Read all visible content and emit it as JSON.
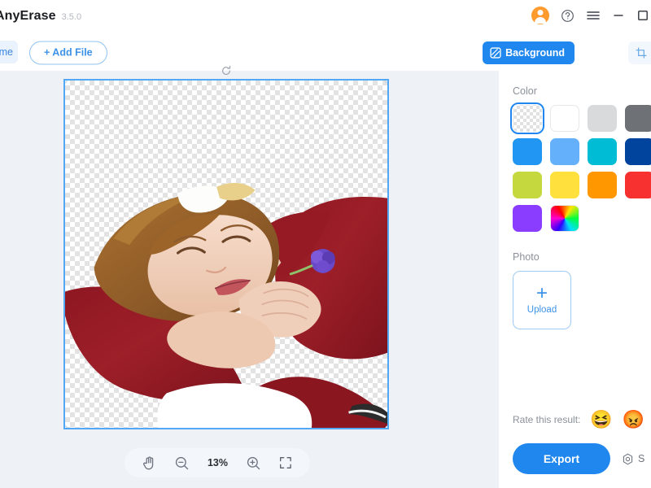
{
  "app": {
    "name": "AnyErase",
    "version": "3.5.0"
  },
  "titlebar": {
    "icons": [
      {
        "name": "account-avatar-icon",
        "label": "account"
      },
      {
        "name": "help-icon",
        "label": "?"
      },
      {
        "name": "menu-icon",
        "label": "menu"
      },
      {
        "name": "minimize-icon",
        "label": "minimize"
      },
      {
        "name": "maximize-icon",
        "label": "maximize"
      }
    ]
  },
  "toolbar": {
    "home_label": "Home",
    "home_visible_text": "me",
    "add_file_label": "+ Add File",
    "background_label": "Background",
    "resize_label": "Re",
    "resize_full_label": "Resize"
  },
  "editor": {
    "zoom_level": "13%",
    "tools": [
      {
        "name": "pan-tool",
        "label": "hand"
      },
      {
        "name": "zoom-out-button",
        "label": "zoom out"
      },
      {
        "name": "zoom-in-button",
        "label": "zoom in"
      },
      {
        "name": "fit-screen-button",
        "label": "fit to screen"
      }
    ],
    "canvas": {
      "transparent_background": true,
      "selected": true,
      "subject_description": "Woman with auburn hair in dark red dress resting head on folded hands, purple flower"
    }
  },
  "panel": {
    "color": {
      "title": "Color",
      "swatches": [
        {
          "name": "transparent",
          "hex": "transparent",
          "selected": true
        },
        {
          "name": "white",
          "hex": "#FFFFFF",
          "selected": false
        },
        {
          "name": "light-gray",
          "hex": "#D9DADC",
          "selected": false
        },
        {
          "name": "gray",
          "hex": "#6E7176",
          "selected": false
        },
        {
          "name": "black",
          "hex": "#000000",
          "selected": false
        },
        {
          "name": "blue",
          "hex": "#2196F3",
          "selected": false
        },
        {
          "name": "light-blue",
          "hex": "#64B0FA",
          "selected": false
        },
        {
          "name": "cyan",
          "hex": "#00BCD4",
          "selected": false
        },
        {
          "name": "navy",
          "hex": "#00449E",
          "selected": false
        },
        {
          "name": "teal",
          "hex": "#009688",
          "selected": false
        },
        {
          "name": "yellow-green",
          "hex": "#C5D93E",
          "selected": false
        },
        {
          "name": "yellow",
          "hex": "#FFE03D",
          "selected": false
        },
        {
          "name": "orange",
          "hex": "#FF9800",
          "selected": false
        },
        {
          "name": "red",
          "hex": "#F73030",
          "selected": false
        },
        {
          "name": "salmon",
          "hex": "#FC6060",
          "selected": false
        },
        {
          "name": "purple",
          "hex": "#8B3DFF",
          "selected": false
        },
        {
          "name": "custom-rainbow",
          "hex": "rainbow",
          "selected": false
        }
      ]
    },
    "photo": {
      "title": "Photo",
      "upload_label": "Upload",
      "upload_plus": "+"
    },
    "rate": {
      "label": "Rate this result:",
      "happy_emoji": "😆",
      "angry_emoji": "😡"
    },
    "actions": {
      "export_label": "Export",
      "settings_label": "S",
      "settings_full_label": "Settings"
    }
  }
}
